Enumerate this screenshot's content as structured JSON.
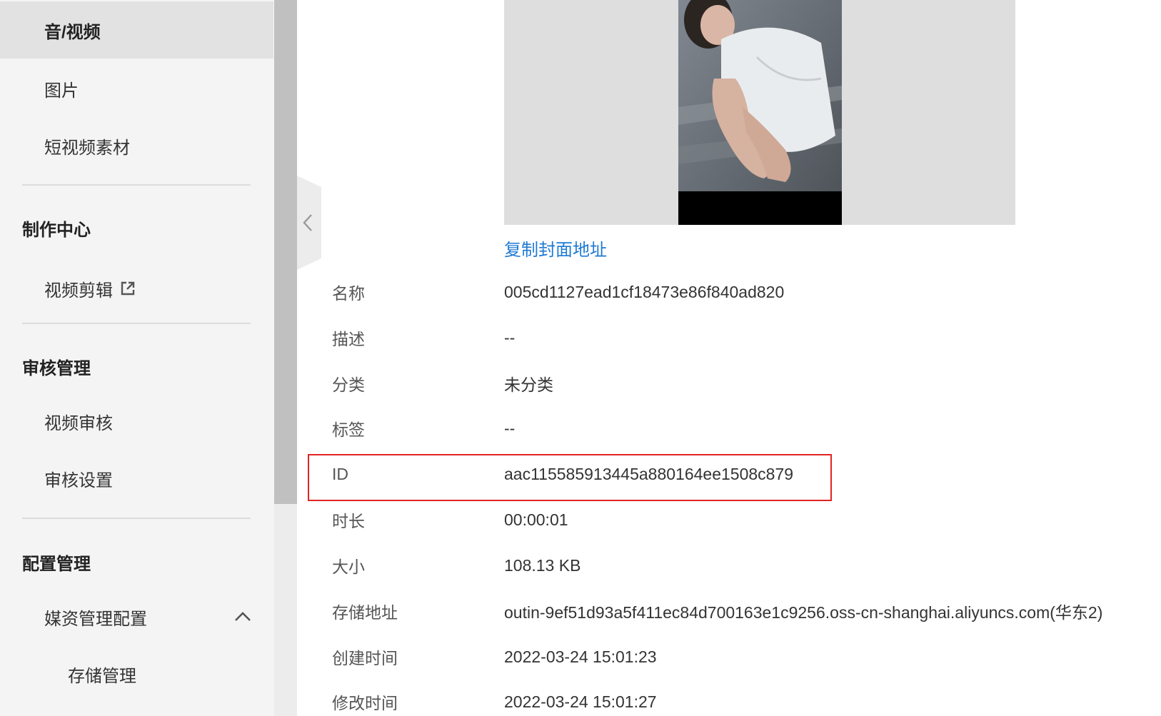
{
  "sidebar": {
    "items_top": [
      {
        "label": "音/视频",
        "active": true
      },
      {
        "label": "图片"
      },
      {
        "label": "短视频素材"
      }
    ],
    "group_production": {
      "title": "制作中心",
      "items": [
        {
          "label": "视频剪辑",
          "icon": "external-link-icon"
        }
      ]
    },
    "group_review": {
      "title": "审核管理",
      "items": [
        {
          "label": "视频审核"
        },
        {
          "label": "审核设置"
        }
      ]
    },
    "group_config": {
      "title": "配置管理",
      "items": [
        {
          "label": "媒资管理配置",
          "icon": "chevron-up-icon",
          "expanded": true
        }
      ],
      "subitems": [
        {
          "label": "存储管理"
        }
      ]
    }
  },
  "main": {
    "copy_cover_link": "复制封面地址",
    "details": [
      {
        "label": "名称",
        "value": "005cd1127ead1cf18473e86f840ad820"
      },
      {
        "label": "描述",
        "value": "--"
      },
      {
        "label": "分类",
        "value": "未分类"
      },
      {
        "label": "标签",
        "value": "--"
      },
      {
        "label": "ID",
        "value": "aac115585913445a880164ee1508c879",
        "highlighted": true
      },
      {
        "label": "时长",
        "value": "00:00:01"
      },
      {
        "label": "大小",
        "value": "108.13 KB"
      },
      {
        "label": "存储地址",
        "value": "outin-9ef51d93a5f411ec84d700163e1c9256.oss-cn-shanghai.aliyuncs.com(华东2)"
      },
      {
        "label": "创建时间",
        "value": "2022-03-24 15:01:23"
      },
      {
        "label": "修改时间",
        "value": "2022-03-24 15:01:27"
      }
    ]
  },
  "colors": {
    "link": "#1f7ad3",
    "highlight_border": "#e02424",
    "sidebar_bg": "#f4f4f4",
    "active_bg": "#e2e2e2"
  }
}
